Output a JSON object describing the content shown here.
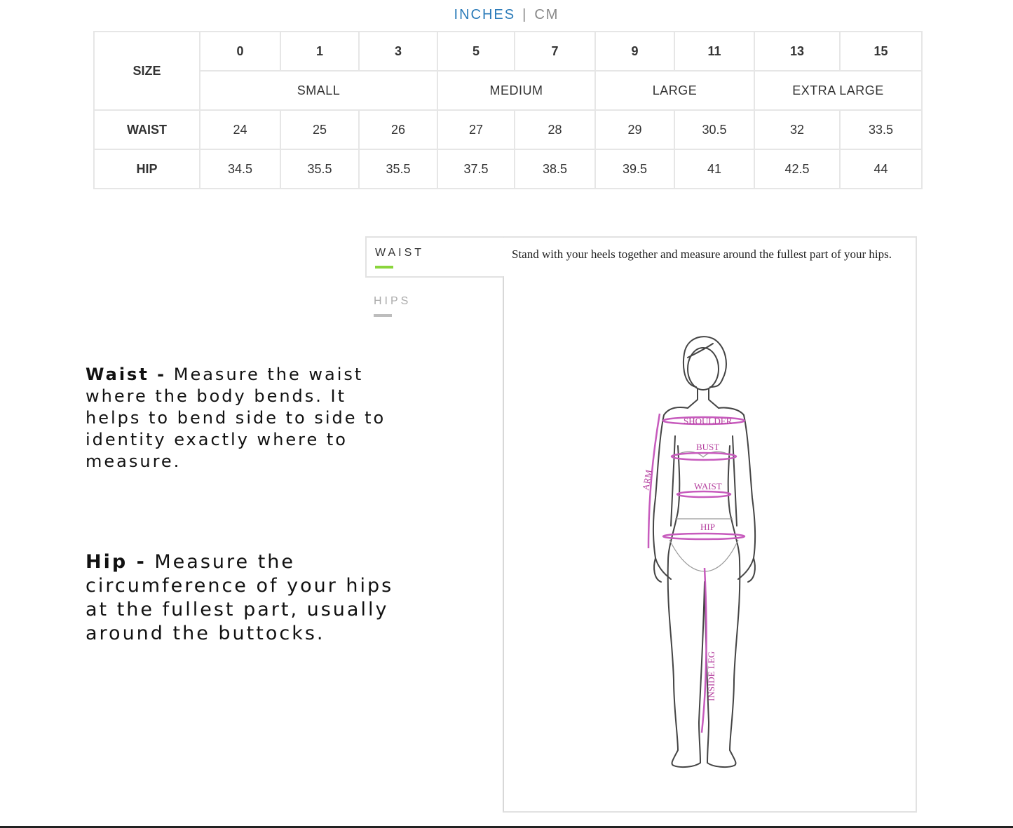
{
  "units": {
    "inches": "INCHES",
    "separator": "|",
    "cm": "CM"
  },
  "table": {
    "size_label": "SIZE",
    "sizes": [
      "0",
      "1",
      "3",
      "5",
      "7",
      "9",
      "11",
      "13",
      "15"
    ],
    "groups": [
      "SMALL",
      "MEDIUM",
      "LARGE",
      "EXTRA LARGE"
    ],
    "waist_label": "WAIST",
    "waist": [
      "24",
      "25",
      "26",
      "27",
      "28",
      "29",
      "30.5",
      "32",
      "33.5"
    ],
    "hip_label": "HIP",
    "hip": [
      "34.5",
      "35.5",
      "35.5",
      "37.5",
      "38.5",
      "39.5",
      "41",
      "42.5",
      "44"
    ]
  },
  "tabs": [
    {
      "label": "WAIST",
      "active": true,
      "underline_color": "#8ad53c"
    },
    {
      "label": "HIPS",
      "active": false,
      "underline_color": "#bdbdbd"
    }
  ],
  "panel": {
    "instruction": "Stand with your heels together and measure around the fullest part of your hips."
  },
  "figure": {
    "labels": {
      "shoulder": "SHOULDER",
      "bust": "BUST",
      "waist": "WAIST",
      "hip": "HIP",
      "arm": "ARM",
      "inside_leg": "INSIDE LEG"
    },
    "measure_color": "#c75bbd"
  },
  "descriptions": {
    "waist_title": "Waist -",
    "waist_text": " Measure the waist where the body bends. It helps to bend side to side to identity exactly where to measure.",
    "hip_title": "Hip -",
    "hip_text": " Measure the circumference of your hips at the fullest part, usually around the buttocks."
  }
}
